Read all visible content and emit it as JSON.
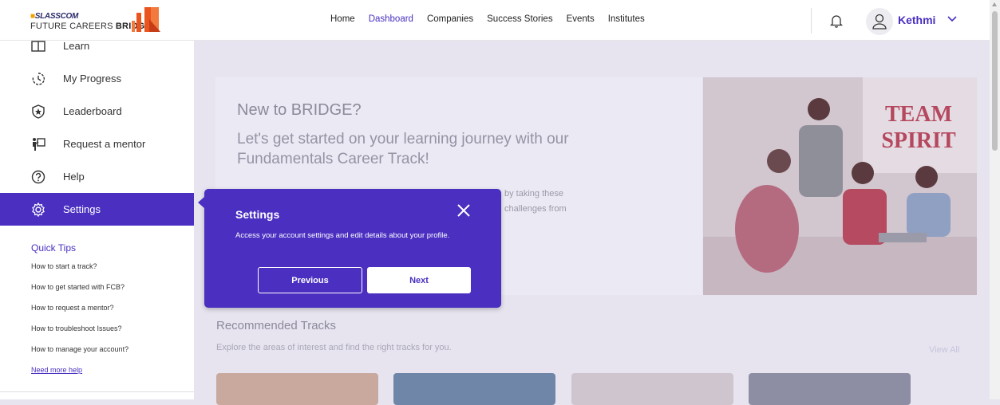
{
  "brand": {
    "line1": "SLASSCOM",
    "line2_prefix": "FUTURE CAREERS ",
    "line2_bold": "BRIDGE"
  },
  "nav": {
    "items": [
      "Home",
      "Dashboard",
      "Companies",
      "Success Stories",
      "Events",
      "Institutes"
    ],
    "active": "Dashboard"
  },
  "user": {
    "name": "Kethmi"
  },
  "sidebar": {
    "items": [
      {
        "label": "Learn",
        "icon": "book-icon"
      },
      {
        "label": "My Progress",
        "icon": "progress-clock-icon"
      },
      {
        "label": "Leaderboard",
        "icon": "shield-star-icon"
      },
      {
        "label": "Request a mentor",
        "icon": "mentor-board-icon"
      },
      {
        "label": "Help",
        "icon": "help-circle-icon"
      },
      {
        "label": "Settings",
        "icon": "gear-icon"
      }
    ],
    "active": "Settings",
    "quick_tips": {
      "title": "Quick Tips",
      "items": [
        "How to start a track?",
        "How to get started with FCB?",
        "How to request a mentor?",
        "How to troubleshoot Issues?",
        "How to manage your account?"
      ],
      "more": "Need more help"
    }
  },
  "hero": {
    "title": "New to BRIDGE?",
    "subtitle": "Let's get started on your learning journey with our Fundamentals Career Track!",
    "body_line1": "by taking these",
    "body_line2": "challenges from"
  },
  "recommended": {
    "title": "Recommended Tracks",
    "subtitle": "Explore the areas of interest and find the right tracks for you.",
    "view_all": "View All"
  },
  "popup": {
    "title": "Settings",
    "body": "Access your account settings and edit details about your profile.",
    "previous": "Previous",
    "next": "Next"
  },
  "colors": {
    "accent": "#4a2fc1",
    "overlay_bg": "#e7e4f0"
  }
}
